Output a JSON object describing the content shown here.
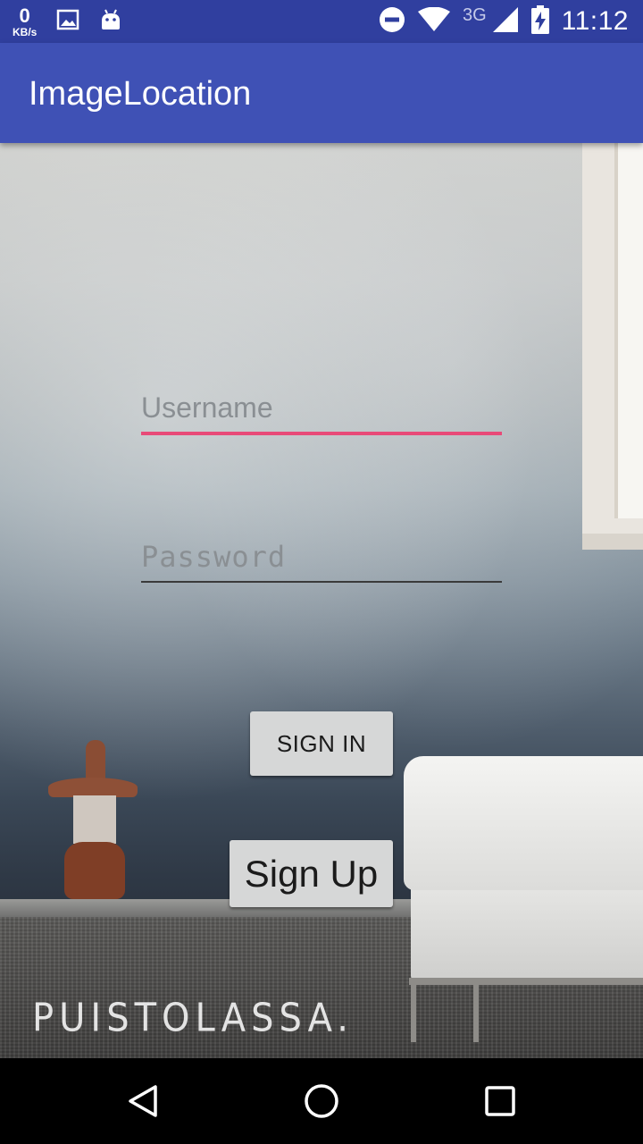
{
  "status_bar": {
    "speed_value": "0",
    "speed_unit": "KB/s",
    "network_label": "3G",
    "time": "11:12"
  },
  "app_bar": {
    "title": "ImageLocation"
  },
  "form": {
    "username_placeholder": "Username",
    "password_placeholder": "Password",
    "sign_in_label": "SIGN IN",
    "sign_up_label": "Sign Up"
  },
  "background": {
    "watermark": "PUISTOLASSA."
  },
  "colors": {
    "status_bar": "#303f9f",
    "app_bar": "#3f51b5",
    "accent": "#e84a78"
  },
  "icons": {
    "status_left": [
      "image-notification-icon",
      "android-notification-icon"
    ],
    "status_right": [
      "do-not-disturb-icon",
      "wifi-icon",
      "cell-signal-icon",
      "battery-charging-icon"
    ],
    "nav": [
      "back-icon",
      "home-icon",
      "recents-icon"
    ]
  }
}
